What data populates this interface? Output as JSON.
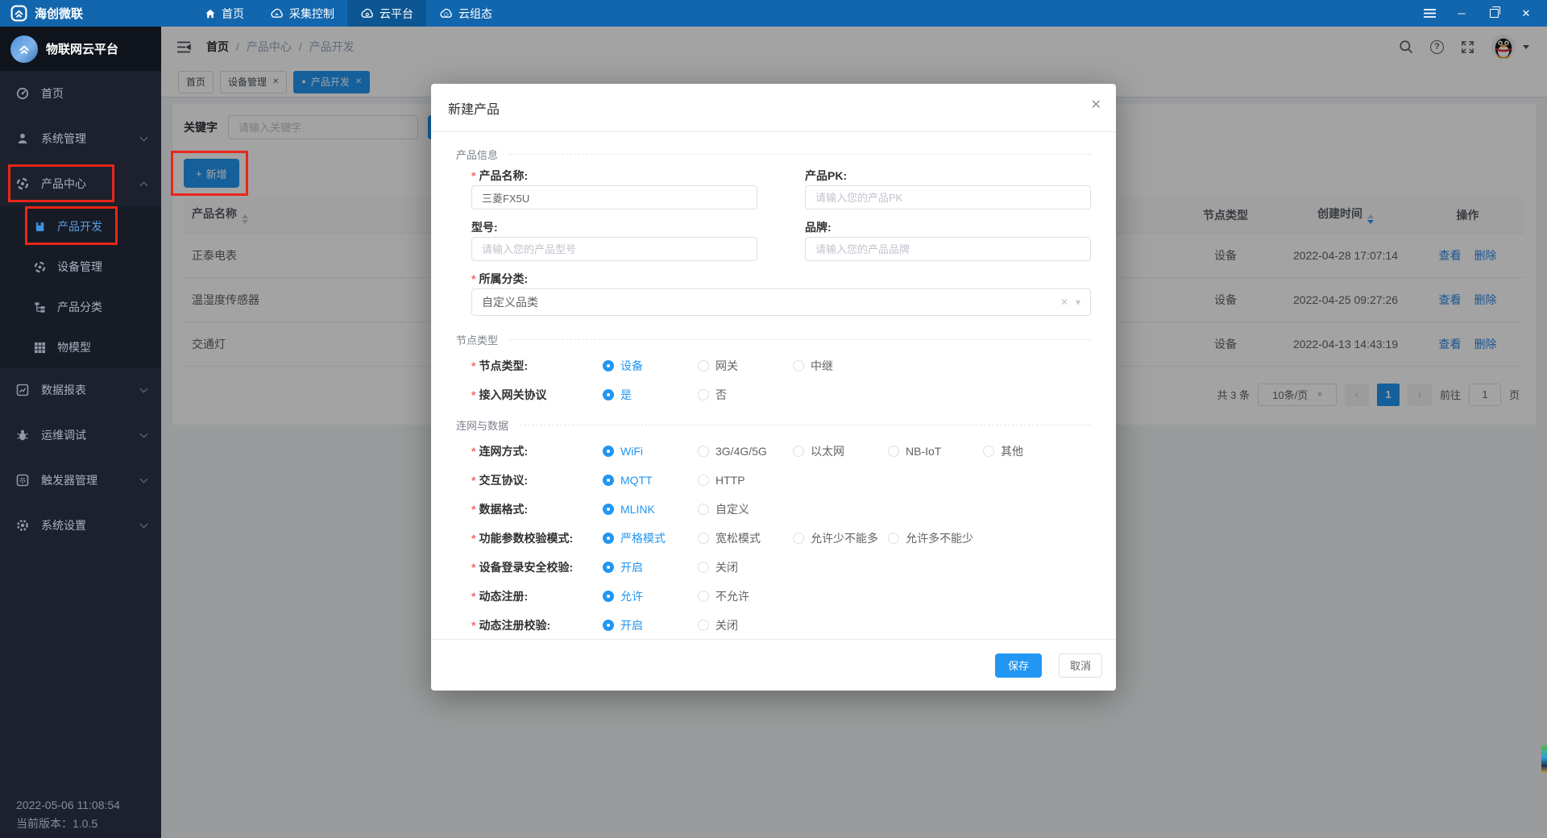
{
  "required_mark": "*",
  "icons": {
    "close": "✕",
    "help": "?",
    "caret_down": "▾",
    "chevron_left": "‹",
    "chevron_right": "›",
    "dot": "●",
    "minimize": "─",
    "plus": "+"
  },
  "colors": {
    "primary": "#2196f3",
    "topbar": "#1266ad",
    "sidebar": "#1c212d",
    "annotation_red": "#e8261a"
  },
  "topbar": {
    "app_name": "海创微联",
    "nav": [
      {
        "label": "首页"
      },
      {
        "label": "采集控制"
      },
      {
        "label": "云平台"
      },
      {
        "label": "云组态"
      }
    ]
  },
  "sidebar": {
    "title": "物联网云平台",
    "items": [
      {
        "label": "首页"
      },
      {
        "label": "系统管理"
      },
      {
        "label": "产品中心"
      },
      {
        "label": "数据报表"
      },
      {
        "label": "运维调试"
      },
      {
        "label": "触发器管理"
      },
      {
        "label": "系统设置"
      }
    ],
    "product_submenu": [
      {
        "label": "产品开发"
      },
      {
        "label": "设备管理"
      },
      {
        "label": "产品分类"
      },
      {
        "label": "物模型"
      }
    ],
    "footer": {
      "timestamp": "2022-05-06 11:08:54",
      "version": "当前版本：1.0.5"
    }
  },
  "header": {
    "breadcrumb": [
      "首页",
      "产品中心",
      "产品开发"
    ],
    "separator": "/",
    "tabs": [
      {
        "label": "首页"
      },
      {
        "label": "设备管理"
      },
      {
        "label": "产品开发"
      }
    ]
  },
  "toolbar": {
    "keyword_label": "关键字",
    "keyword_placeholder": "请输入关键字",
    "add_button": "新增"
  },
  "table": {
    "columns": [
      "产品名称",
      "节点类型",
      "创建时间",
      "操作"
    ],
    "rows": [
      {
        "name": "正泰电表",
        "node_type": "设备",
        "created": "2022-04-28 17:07:14"
      },
      {
        "name": "温湿度传感器",
        "node_type": "设备",
        "created": "2022-04-25 09:27:26"
      },
      {
        "name": "交通灯",
        "node_type": "设备",
        "created": "2022-04-13 14:43:19"
      }
    ],
    "action_view": "查看",
    "action_delete": "删除"
  },
  "pagination": {
    "total": "共 3 条",
    "page_size": "10条/页",
    "current_page": "1",
    "goto_label": "前往",
    "goto_value": "1",
    "page_unit": "页"
  },
  "modal": {
    "title": "新建产品",
    "sections": {
      "info": "产品信息",
      "node": "节点类型",
      "conn": "连网与数据"
    },
    "fields": {
      "name": {
        "label": "产品名称:",
        "value": "三菱FX5U"
      },
      "pk": {
        "label": "产品PK:",
        "placeholder": "请输入您的产品PK"
      },
      "model": {
        "label": "型号:",
        "placeholder": "请输入您的产品型号"
      },
      "brand": {
        "label": "品牌:",
        "placeholder": "请输入您的产品品牌"
      },
      "category": {
        "label": "所属分类:",
        "value": "自定义品类"
      }
    },
    "groups": [
      {
        "label": "节点类型:",
        "selected": 0,
        "options": [
          "设备",
          "网关",
          "中继"
        ]
      },
      {
        "label": "接入网关协议",
        "selected": 0,
        "options": [
          "是",
          "否"
        ]
      },
      {
        "label": "连网方式:",
        "selected": 0,
        "options": [
          "WiFi",
          "3G/4G/5G",
          "以太网",
          "NB-IoT",
          "其他"
        ]
      },
      {
        "label": "交互协议:",
        "selected": 0,
        "options": [
          "MQTT",
          "HTTP"
        ]
      },
      {
        "label": "数据格式:",
        "selected": 0,
        "options": [
          "MLINK",
          "自定义"
        ]
      },
      {
        "label": "功能参数校验模式:",
        "selected": 0,
        "options": [
          "严格模式",
          "宽松模式",
          "允许少不能多",
          "允许多不能少"
        ]
      },
      {
        "label": "设备登录安全校验:",
        "selected": 0,
        "options": [
          "开启",
          "关闭"
        ]
      },
      {
        "label": "动态注册:",
        "selected": 0,
        "options": [
          "允许",
          "不允许"
        ]
      },
      {
        "label": "动态注册校验:",
        "selected": 0,
        "options": [
          "开启",
          "关闭"
        ]
      }
    ],
    "save_button": "保存",
    "cancel_button": "取消"
  }
}
